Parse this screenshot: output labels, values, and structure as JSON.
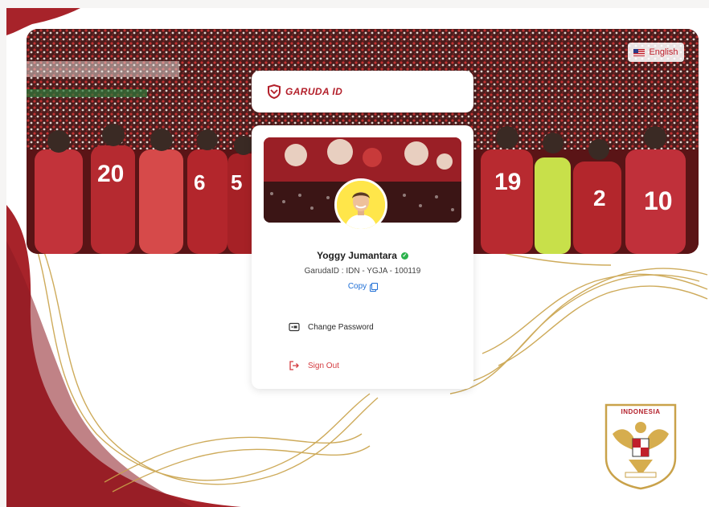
{
  "language_button": {
    "label": "English",
    "flag_icon": "us-flag-icon"
  },
  "brand": {
    "logo_icon": "garuda-shield-icon",
    "name": "GARUDA ID"
  },
  "profile": {
    "name": "Yoggy Jumantara",
    "verified_icon": "verified-check-icon",
    "garuda_id": "GarudaID : IDN - YGJA - 100119",
    "copy_label": "Copy"
  },
  "menu": {
    "change_password": "Change Password",
    "sign_out": "Sign Out"
  },
  "emblem": {
    "label": "INDONESIA"
  },
  "colors": {
    "brand_red": "#b3202b",
    "signout_red": "#d43a3f",
    "link_blue": "#1f6fd6",
    "verified_green": "#2bb24c",
    "gold": "#c9a24a"
  }
}
